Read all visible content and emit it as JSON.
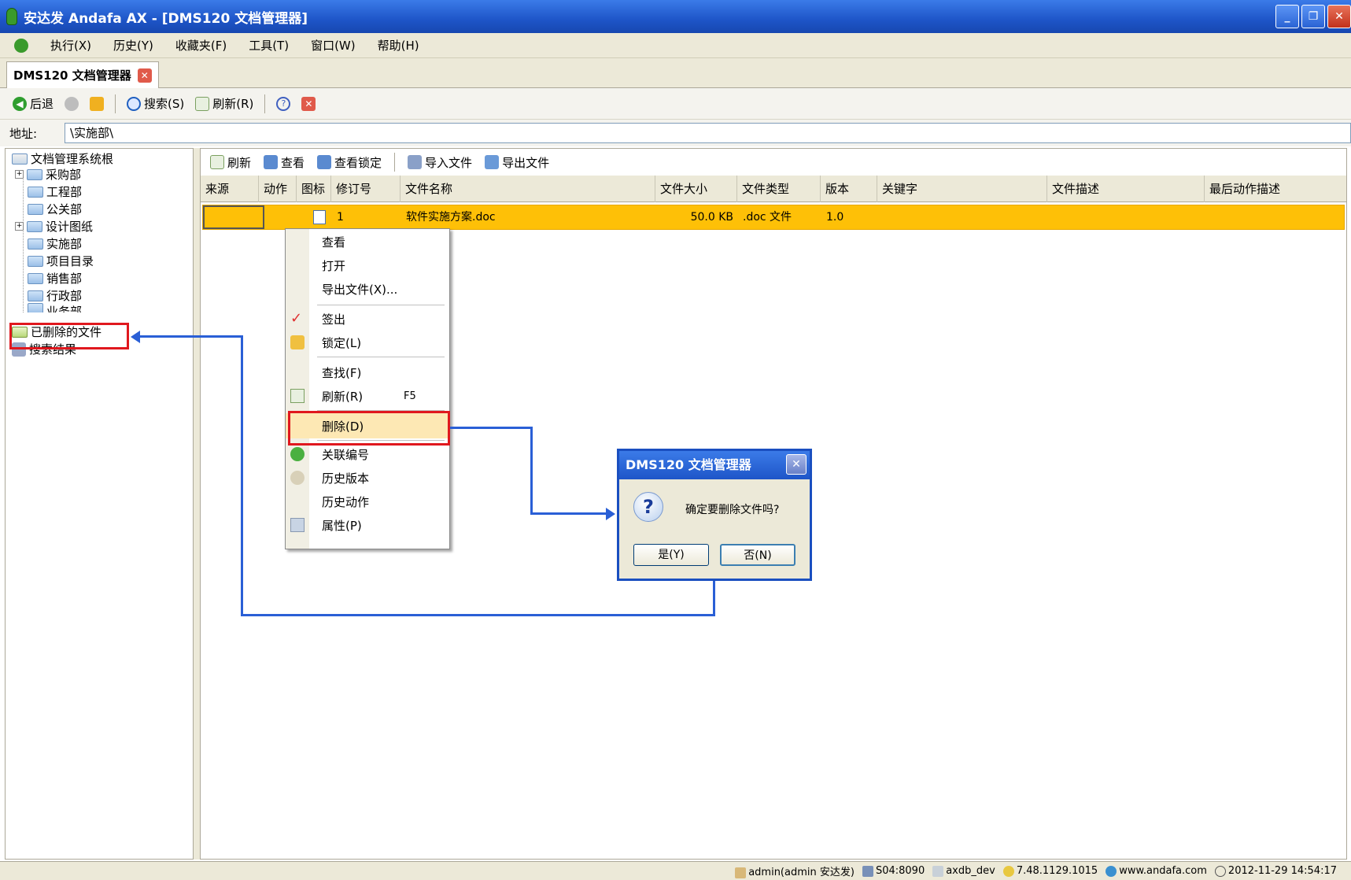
{
  "window": {
    "title": "安达发 Andafa AX - [DMS120 文档管理器]"
  },
  "menubar": {
    "items": [
      "执行(X)",
      "历史(Y)",
      "收藏夹(F)",
      "工具(T)",
      "窗口(W)",
      "帮助(H)"
    ]
  },
  "doc_tab": {
    "label": "DMS120 文档管理器"
  },
  "toolbar": {
    "back_label": "后退",
    "search_label": "搜索(S)",
    "refresh_label": "刷新(R)"
  },
  "address": {
    "label": "地址:",
    "value": "\\实施部\\"
  },
  "tree": {
    "root": "文档管理系统根",
    "children": [
      "采购部",
      "工程部",
      "公关部",
      "设计图纸",
      "实施部",
      "项目目录",
      "销售部",
      "行政部",
      "业务部"
    ],
    "deleted": "已删除的文件",
    "search_results": "搜索结果"
  },
  "main_toolbar": {
    "refresh": "刷新",
    "view": "查看",
    "view_locked": "查看锁定",
    "import": "导入文件",
    "export": "导出文件"
  },
  "grid": {
    "columns": [
      "来源",
      "动作",
      "图标",
      "修订号",
      "文件名称",
      "文件大小",
      "文件类型",
      "版本",
      "关键字",
      "文件描述",
      "最后动作描述"
    ],
    "rows": [
      {
        "revision": "1",
        "name": "软件实施方案.doc",
        "size": "50.0 KB",
        "type": ".doc 文件",
        "version": "1.0"
      }
    ]
  },
  "context_menu": {
    "view": "查看",
    "open": "打开",
    "export": "导出文件(X)...",
    "checkout": "签出",
    "lock": "锁定(L)",
    "find": "查找(F)",
    "refresh": "刷新(R)",
    "refresh_shortcut": "F5",
    "delete": "删除(D)",
    "link_no": "关联编号",
    "history_version": "历史版本",
    "history_action": "历史动作",
    "properties": "属性(P)"
  },
  "dialog": {
    "title": "DMS120 文档管理器",
    "message": "确定要删除文件吗?",
    "yes": "是(Y)",
    "no": "否(N)"
  },
  "statusbar": {
    "user": "admin(admin 安达发)",
    "server": "S04:8090",
    "db": "axdb_dev",
    "version": "7.48.1129.1015",
    "website": "www.andafa.com",
    "datetime": "2012-11-29 14:54:17"
  },
  "colors": {
    "selection": "#fec007",
    "annotation_red": "#e0181e",
    "annotation_arrow": "#2a5fd6",
    "title_blue": "#1e55c8"
  }
}
